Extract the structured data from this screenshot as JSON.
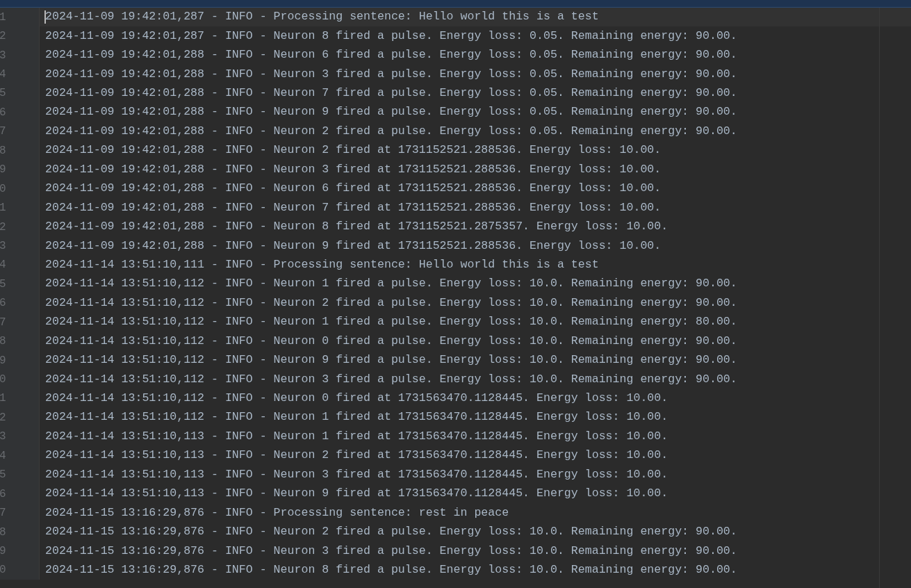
{
  "lines": [
    {
      "number": "1",
      "text": "2024-11-09 19:42:01,287 - INFO - Processing sentence: Hello world this is a test",
      "selected": true
    },
    {
      "number": "2",
      "text": "2024-11-09 19:42:01,287 - INFO - Neuron 8 fired a pulse. Energy loss: 0.05. Remaining energy: 90.00.",
      "selected": false
    },
    {
      "number": "3",
      "text": "2024-11-09 19:42:01,288 - INFO - Neuron 6 fired a pulse. Energy loss: 0.05. Remaining energy: 90.00.",
      "selected": false
    },
    {
      "number": "4",
      "text": "2024-11-09 19:42:01,288 - INFO - Neuron 3 fired a pulse. Energy loss: 0.05. Remaining energy: 90.00.",
      "selected": false
    },
    {
      "number": "5",
      "text": "2024-11-09 19:42:01,288 - INFO - Neuron 7 fired a pulse. Energy loss: 0.05. Remaining energy: 90.00.",
      "selected": false
    },
    {
      "number": "6",
      "text": "2024-11-09 19:42:01,288 - INFO - Neuron 9 fired a pulse. Energy loss: 0.05. Remaining energy: 90.00.",
      "selected": false
    },
    {
      "number": "7",
      "text": "2024-11-09 19:42:01,288 - INFO - Neuron 2 fired a pulse. Energy loss: 0.05. Remaining energy: 90.00.",
      "selected": false
    },
    {
      "number": "8",
      "text": "2024-11-09 19:42:01,288 - INFO - Neuron 2 fired at 1731152521.288536. Energy loss: 10.00.",
      "selected": false
    },
    {
      "number": "9",
      "text": "2024-11-09 19:42:01,288 - INFO - Neuron 3 fired at 1731152521.288536. Energy loss: 10.00.",
      "selected": false
    },
    {
      "number": "0",
      "text": "2024-11-09 19:42:01,288 - INFO - Neuron 6 fired at 1731152521.288536. Energy loss: 10.00.",
      "selected": false
    },
    {
      "number": "1",
      "text": "2024-11-09 19:42:01,288 - INFO - Neuron 7 fired at 1731152521.288536. Energy loss: 10.00.",
      "selected": false
    },
    {
      "number": "2",
      "text": "2024-11-09 19:42:01,288 - INFO - Neuron 8 fired at 1731152521.2875357. Energy loss: 10.00.",
      "selected": false
    },
    {
      "number": "3",
      "text": "2024-11-09 19:42:01,288 - INFO - Neuron 9 fired at 1731152521.288536. Energy loss: 10.00.",
      "selected": false
    },
    {
      "number": "4",
      "text": "2024-11-14 13:51:10,111 - INFO - Processing sentence: Hello world this is a test",
      "selected": false
    },
    {
      "number": "5",
      "text": "2024-11-14 13:51:10,112 - INFO - Neuron 1 fired a pulse. Energy loss: 10.0. Remaining energy: 90.00.",
      "selected": false
    },
    {
      "number": "6",
      "text": "2024-11-14 13:51:10,112 - INFO - Neuron 2 fired a pulse. Energy loss: 10.0. Remaining energy: 90.00.",
      "selected": false
    },
    {
      "number": "7",
      "text": "2024-11-14 13:51:10,112 - INFO - Neuron 1 fired a pulse. Energy loss: 10.0. Remaining energy: 80.00.",
      "selected": false
    },
    {
      "number": "8",
      "text": "2024-11-14 13:51:10,112 - INFO - Neuron 0 fired a pulse. Energy loss: 10.0. Remaining energy: 90.00.",
      "selected": false
    },
    {
      "number": "9",
      "text": "2024-11-14 13:51:10,112 - INFO - Neuron 9 fired a pulse. Energy loss: 10.0. Remaining energy: 90.00.",
      "selected": false
    },
    {
      "number": "0",
      "text": "2024-11-14 13:51:10,112 - INFO - Neuron 3 fired a pulse. Energy loss: 10.0. Remaining energy: 90.00.",
      "selected": false
    },
    {
      "number": "1",
      "text": "2024-11-14 13:51:10,112 - INFO - Neuron 0 fired at 1731563470.1128445. Energy loss: 10.00.",
      "selected": false
    },
    {
      "number": "2",
      "text": "2024-11-14 13:51:10,112 - INFO - Neuron 1 fired at 1731563470.1128445. Energy loss: 10.00.",
      "selected": false
    },
    {
      "number": "3",
      "text": "2024-11-14 13:51:10,113 - INFO - Neuron 1 fired at 1731563470.1128445. Energy loss: 10.00.",
      "selected": false
    },
    {
      "number": "4",
      "text": "2024-11-14 13:51:10,113 - INFO - Neuron 2 fired at 1731563470.1128445. Energy loss: 10.00.",
      "selected": false
    },
    {
      "number": "5",
      "text": "2024-11-14 13:51:10,113 - INFO - Neuron 3 fired at 1731563470.1128445. Energy loss: 10.00.",
      "selected": false
    },
    {
      "number": "6",
      "text": "2024-11-14 13:51:10,113 - INFO - Neuron 9 fired at 1731563470.1128445. Energy loss: 10.00.",
      "selected": false
    },
    {
      "number": "7",
      "text": "2024-11-15 13:16:29,876 - INFO - Processing sentence: rest in peace",
      "selected": false
    },
    {
      "number": "8",
      "text": "2024-11-15 13:16:29,876 - INFO - Neuron 2 fired a pulse. Energy loss: 10.0. Remaining energy: 90.00.",
      "selected": false
    },
    {
      "number": "9",
      "text": "2024-11-15 13:16:29,876 - INFO - Neuron 3 fired a pulse. Energy loss: 10.0. Remaining energy: 90.00.",
      "selected": false
    },
    {
      "number": "0",
      "text": "2024-11-15 13:16:29,876 - INFO - Neuron 8 fired a pulse. Energy loss: 10.0. Remaining energy: 90.00.",
      "selected": false
    }
  ]
}
